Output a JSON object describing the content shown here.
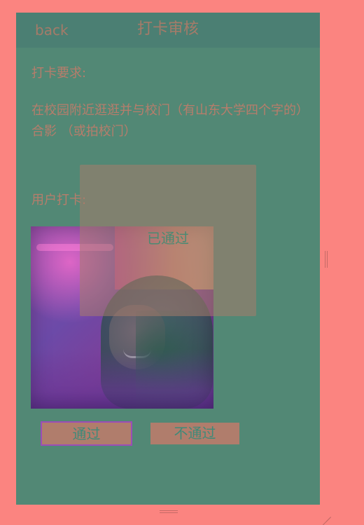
{
  "header": {
    "back_label": "back",
    "title": "打卡审核"
  },
  "requirement": {
    "label": "打卡要求:",
    "text": "在校园附近逛逛并与校门（有山东大学四个字的）合影 （或拍校门）"
  },
  "user_checkin": {
    "label": "用户打卡:"
  },
  "overlay": {
    "status_text": "已通过"
  },
  "actions": {
    "pass_label": "通过",
    "fail_label": "不通过"
  }
}
